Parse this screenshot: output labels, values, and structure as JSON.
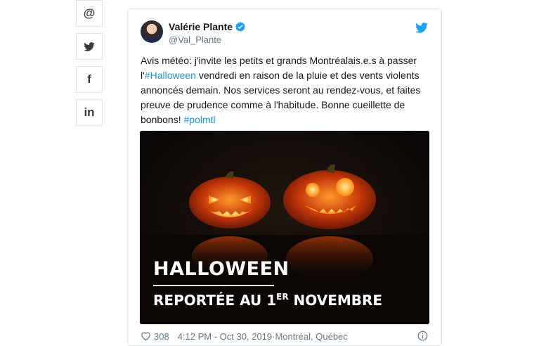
{
  "share": {
    "email_symbol": "@",
    "facebook_symbol": "f",
    "linkedin_symbol": "in"
  },
  "tweet": {
    "author_name": "Valérie Plante",
    "handle": "@Val_Plante",
    "text_1": "Avis météo: j'invite les petits et grands Montréalais.e.s à passer l'",
    "hashtag_1": "#Halloween",
    "text_2": " vendredi en raison de la pluie et des vents violents annoncés demain. Nos services seront au rendez-vous, et faites preuve de prudence comme à l'habitude. Bonne cueillette de bonbons! ",
    "hashtag_2": "#polmtl",
    "media": {
      "title": "HALLOWEEN",
      "subtitle_prefix": "REPORTÉE AU 1",
      "subtitle_sup": "ER",
      "subtitle_suffix": " NOVEMBRE"
    },
    "likes": "308",
    "timestamp": "4:12 PM - Oct 30, 2019",
    "separator": " · ",
    "location": "Montréal, Québec"
  },
  "colors": {
    "link": "#1b95e0",
    "muted": "#657786",
    "twitter_blue": "#1da1f2"
  },
  "icons": [
    "email-icon",
    "twitter-icon",
    "facebook-icon",
    "linkedin-icon",
    "verified-icon",
    "heart-icon",
    "info-icon"
  ]
}
